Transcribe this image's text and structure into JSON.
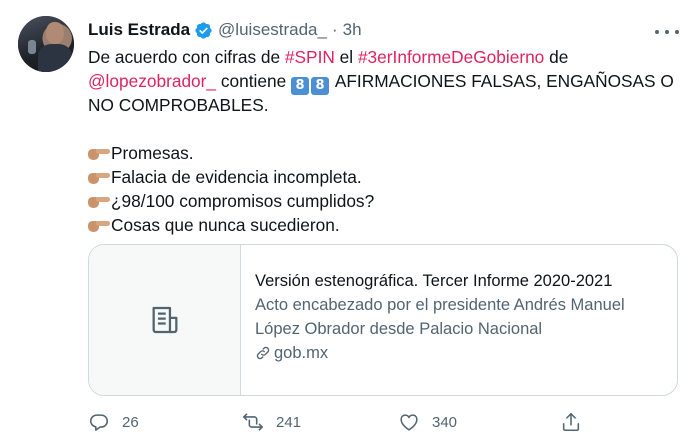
{
  "tweet": {
    "author_name": "Luis Estrada",
    "handle": "@luisestrada_",
    "separator": "·",
    "time": "3h",
    "lines": {
      "l1_prefix": "De acuerdo con cifras de ",
      "l1_tag1": "#SPIN",
      "l1_mid": " el ",
      "l1_tag2": "#3erInformeDeGobierno",
      "l1_suffix": " de",
      "l2_mention": "@lopezobrador_",
      "l2_mid": " contiene ",
      "l2_digit1": "8",
      "l2_digit2": "8",
      "l2_suffix": " AFIRMACIONES FALSAS, ENGAÑOSAS O",
      "l3": "NO COMPROBABLES.",
      "bullet1": "Promesas.",
      "bullet2": "Falacia de evidencia incompleta.",
      "bullet3": "¿98/100 compromisos cumplidos?",
      "bullet4": "Cosas que nunca sucedieron."
    }
  },
  "card": {
    "title": "Versión estenográfica. Tercer Informe 2020-2021",
    "desc_line1": "Acto encabezado por el presidente Andrés Manuel",
    "desc_line2": "López Obrador desde Palacio Nacional",
    "domain": "gob.mx"
  },
  "actions": {
    "replies": "26",
    "retweets": "241",
    "likes": "340"
  },
  "colors": {
    "hashtag": "#e0245e",
    "secondary_text": "#536471",
    "verified": "#1d9bf0",
    "keycap": "#4d8fd4"
  },
  "icons": [
    "verified-badge-icon",
    "more-icon",
    "pointing-hand-icon",
    "document-icon",
    "link-icon",
    "reply-icon",
    "retweet-icon",
    "like-icon",
    "share-icon"
  ]
}
